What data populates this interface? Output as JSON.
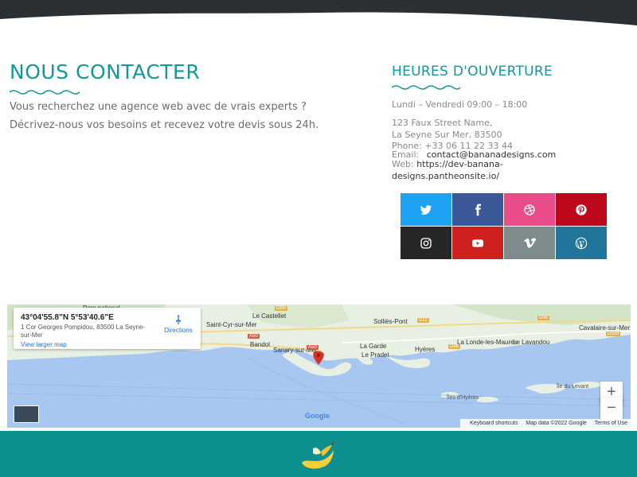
{
  "contact": {
    "title": "NOUS CONTACTER",
    "paragraphs": [
      "Vous recherchez une agence web avec de vrais experts ?",
      "Décrivez-nous vos besoins et recevez votre devis sous 24h."
    ]
  },
  "hours": {
    "title": "HEURES D'OUVERTURE",
    "schedule": "Lundi – Vendredi 09:00 – 18:00",
    "address_line1": "123 Faux Street Name,",
    "address_line2": "La Seyne Sur Mer, 83500",
    "phone": "Phone: +33 06 11 22 33 44",
    "email_label": "Email:",
    "email_value": "contact@bananadesigns.com",
    "web_label": "Web:",
    "web_value_line1": "https://dev-banana-",
    "web_value_line2": "designs.pantheonsite.io/"
  },
  "social": [
    {
      "name": "twitter-icon",
      "color": "#1da1f2"
    },
    {
      "name": "facebook-icon",
      "color": "#3b5998"
    },
    {
      "name": "dribbble-icon",
      "color": "#ea4c89"
    },
    {
      "name": "pinterest-icon",
      "color": "#bd081c"
    },
    {
      "name": "instagram-icon",
      "color": "#262626"
    },
    {
      "name": "youtube-icon",
      "color": "#cd201f"
    },
    {
      "name": "vimeo-icon",
      "color": "#7d8b8c"
    },
    {
      "name": "wordpress-icon",
      "color": "#21759b"
    }
  ],
  "map": {
    "coords": "43°04'55.8\"N 5°53'40.6\"E",
    "address": "1 Cor Georges Pompidou, 83500 La Seyne-sur-Mer",
    "directions": "Directions",
    "view_larger": "View larger map",
    "zoom_in": "+",
    "zoom_out": "−",
    "keyboard_shortcuts": "Keyboard shortcuts",
    "map_data": "Map data ©2022 Google",
    "terms": "Terms of Use",
    "google": "Google",
    "places": {
      "parc": "Parc national",
      "le_castellet": "Le Castellet",
      "saint_cyr": "Saint-Cyr-sur-Mer",
      "sollies_pont": "Solliès-Pont",
      "cavalaire": "Cavalaire-sur-Mer",
      "bandol": "Bandol",
      "sanary": "Sanary-sur-Mer",
      "la_garde": "La Garde",
      "le_pradet": "Le Pradet",
      "hyeres": "Hyères",
      "londe": "La Londe-les-Maures",
      "lavandou": "Le Lavandou",
      "iles": "Îles d'Hyères",
      "levant": "Île du Levant"
    },
    "roads": {
      "a50_a": "A50",
      "a50_b": "A50",
      "d8": "D8N",
      "d12": "D12",
      "d98": "D98",
      "d559": "D559",
      "d98b": "D98"
    }
  },
  "colors": {
    "accent": "#0f9a9a",
    "footer": "#0e9090",
    "top_bar": "#2b3035",
    "map_water": "#a8c7f0",
    "map_land": "#e8efe3",
    "marker": "#d93025"
  }
}
